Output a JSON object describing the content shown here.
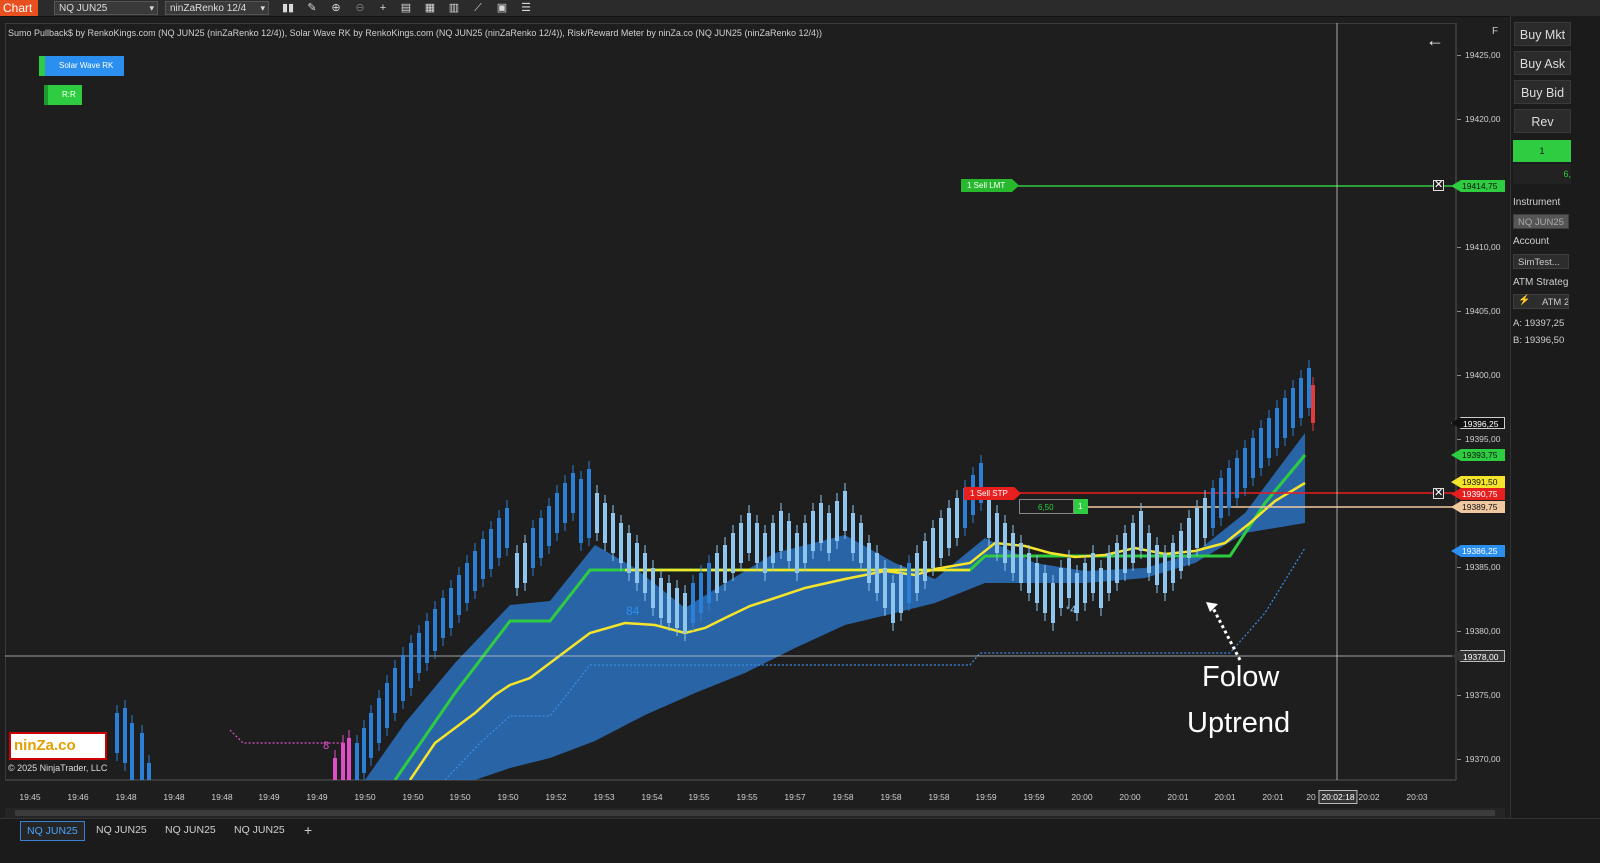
{
  "toolbar": {
    "chart_tab": "Chart",
    "instrument": "NQ JUN25",
    "bar_type": "ninZaRenko 12/4",
    "icons": [
      "bar-type-icon",
      "draw-pencil-icon",
      "zoom-in-icon",
      "zoom-out-icon",
      "crosshair-icon",
      "properties-icon",
      "data-box-icon",
      "strategies-icon",
      "indicators-icon",
      "templates-icon",
      "object-list-icon"
    ]
  },
  "indicator_title": "Sumo Pullback$ by RenkoKings.com (NQ JUN25 (ninZaRenko 12/4)), Solar Wave RK by RenkoKings.com (NQ JUN25 (ninZaRenko 12/4)), Risk/Reward Meter by ninZa.co (NQ JUN25 (ninZaRenko 12/4))",
  "legend": {
    "solar_wave": "Solar Wave RK",
    "rr": "R:R"
  },
  "y_axis": {
    "labels": [
      "19425,00",
      "19420,00",
      "19410,00",
      "19405,00",
      "19400,00",
      "19395,00",
      "19385,00",
      "19380,00",
      "19375,00",
      "19370,00"
    ]
  },
  "price_markers": {
    "sell_lmt": "19414,75",
    "last": "19396,25",
    "level_green": "19393,75",
    "level_yellow": "19391,50",
    "sell_stp": "19390,75",
    "entry": "19389,75",
    "blue": "19386,25",
    "crosshair": "19378,00"
  },
  "orders": {
    "sell_lmt_label": "1  Sell LMT",
    "sell_stp_label": "1  Sell STP",
    "position_pnl": "6,50",
    "position_qty": "1",
    "close_symbol": "✕"
  },
  "x_axis": {
    "labels": [
      "19:45",
      "19:46",
      "19:48",
      "19:48",
      "19:48",
      "19:49",
      "19:49",
      "19:50",
      "19:50",
      "19:50",
      "19:50",
      "19:52",
      "19:53",
      "19:54",
      "19:55",
      "19:55",
      "19:57",
      "19:58",
      "19:58",
      "19:58",
      "19:59",
      "19:59",
      "20:00",
      "20:00",
      "20:01",
      "20:01",
      "20:01",
      "20",
      "20:02:18",
      "20:02",
      "20:03"
    ]
  },
  "chart_marks": {
    "pullback_count_1": "84",
    "pullback_count_2": "*4",
    "pink_count": "8"
  },
  "annotation": {
    "line1": "Folow",
    "line2": "Uptrend"
  },
  "logo": {
    "text": "ninZa.co",
    "copyright": "© 2025 NinjaTrader, LLC"
  },
  "bottom_tabs": [
    "NQ JUN25",
    "NQ JUN25",
    "NQ JUN25",
    "NQ JUN25"
  ],
  "add_tab": "+",
  "right_panel": {
    "f_label": "F",
    "buy_mkt": "Buy Mkt",
    "buy_ask": "Buy Ask",
    "buy_bid": "Buy Bid",
    "rev": "Rev",
    "position_qty": "1",
    "position_val": "6,",
    "instrument_label": "Instrument",
    "instrument_value": "NQ JUN25",
    "account_label": "Account",
    "account_value": "SimTest...",
    "atm_label": "ATM Strateg",
    "atm_value": "ATM 2",
    "ask": "A:  19397,25",
    "bid": "B:  19396,50"
  },
  "back_arrow": "←",
  "colors": {
    "accent_orange": "#e8501f",
    "up_bar": "#2b7fd6",
    "up_bar_light": "#8fc6ee",
    "down_bar": "#e23b3b",
    "band_fill": "#2a6bb5",
    "green_line": "#2ecc40",
    "yellow_line": "#f5e52a",
    "sell_red": "#e81f1f",
    "tab_blue": "#3a7fd0"
  }
}
